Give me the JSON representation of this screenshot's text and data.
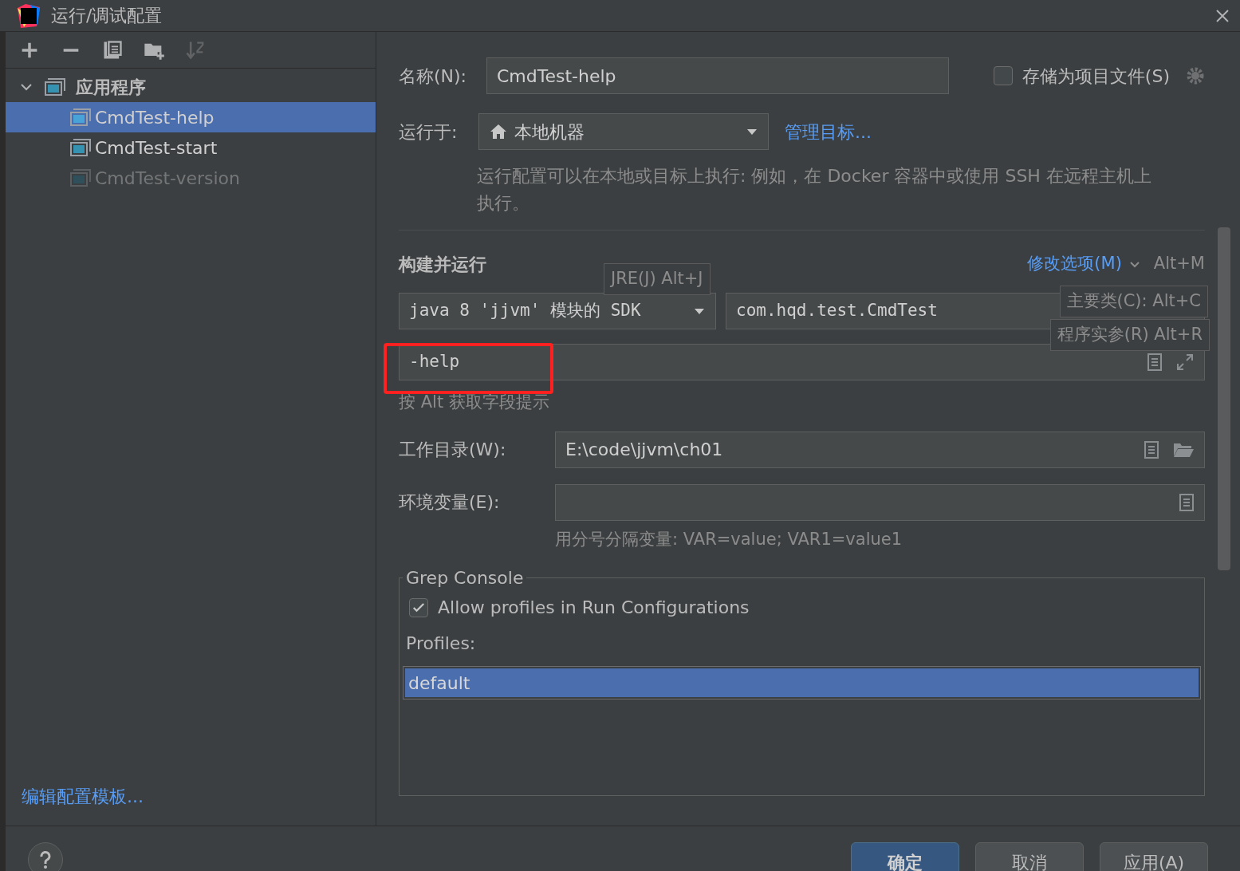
{
  "window": {
    "title": "运行/调试配置"
  },
  "toolbar": {
    "buttons": [
      {
        "kind": "add",
        "disabled": false
      },
      {
        "kind": "remove",
        "disabled": false
      },
      {
        "kind": "copy",
        "disabled": false
      },
      {
        "kind": "folder",
        "disabled": false
      },
      {
        "kind": "sort",
        "disabled": true
      }
    ]
  },
  "tree": {
    "group": {
      "label": "应用程序",
      "expanded": true,
      "children": [
        {
          "label": "CmdTest-help",
          "selected": true,
          "disabled": false
        },
        {
          "label": "CmdTest-start",
          "selected": false,
          "disabled": false
        },
        {
          "label": "CmdTest-version",
          "selected": false,
          "disabled": true
        }
      ]
    }
  },
  "edit_templates_link": "编辑配置模板...",
  "form": {
    "name_label": "名称(N):",
    "name_value": "CmdTest-help",
    "store_checkbox": {
      "label": "存储为项目文件(S)",
      "checked": false
    },
    "run_on_label": "运行于:",
    "run_on_value": "本地机器",
    "manage_targets_link": "管理目标...",
    "description": "运行配置可以在本地或目标上执行: 例如，在 Docker 容器中或使用 SSH 在远程主机上执行。",
    "section_title": "构建并运行",
    "modify_options_link": "修改选项(M)",
    "modify_options_shortcut": "Alt+M",
    "sdk_value": "java 8 'jjvm' 模块的 SDK",
    "main_class_value": "com.hqd.test.CmdTest",
    "program_args_value": "-help",
    "field_hint": "按 Alt 获取字段提示",
    "workdir_label": "工作目录(W):",
    "workdir_value": "E:\\code\\jjvm\\ch01",
    "env_label": "环境变量(E):",
    "env_hint": "用分号分隔变量: VAR=value; VAR1=value1"
  },
  "tooltips": [
    "JRE(J) Alt+J",
    "主要类(C): Alt+C",
    "程序实参(R) Alt+R"
  ],
  "grep_console": {
    "title": "Grep Console",
    "allow_profiles": {
      "label": "Allow profiles in Run Configurations",
      "checked": true
    },
    "profiles_label": "Profiles:",
    "profiles": [
      {
        "label": "default",
        "selected": true
      }
    ]
  },
  "buttons": [
    {
      "label": "确定",
      "primary": true
    },
    {
      "label": "取消",
      "primary": false
    },
    {
      "label": "应用(A)",
      "primary": false
    }
  ]
}
